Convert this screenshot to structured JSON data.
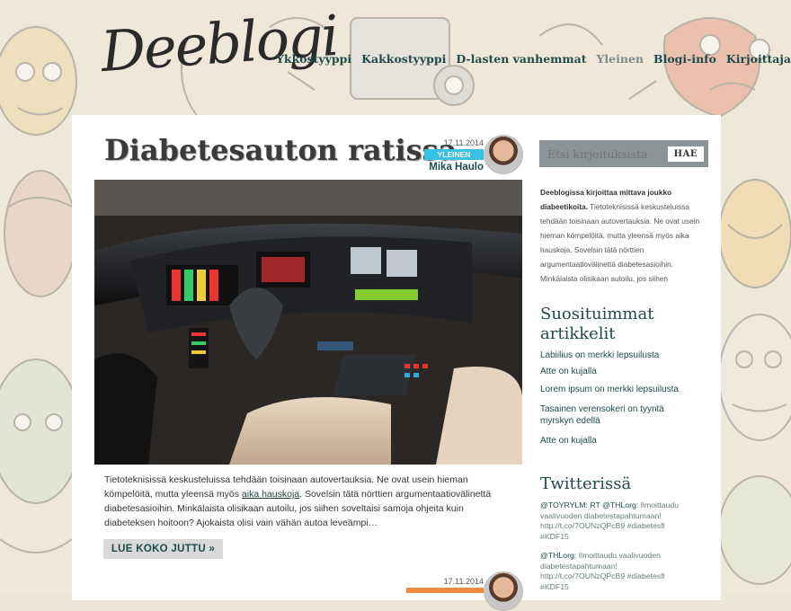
{
  "site": {
    "logo_text": "Deeblogi"
  },
  "nav": {
    "items": [
      {
        "label": "Ykköstyyppi",
        "active": false
      },
      {
        "label": "Kakkostyyppi",
        "active": false
      },
      {
        "label": "D-lasten vanhemmat",
        "active": false
      },
      {
        "label": "Yleinen",
        "active": true
      },
      {
        "label": "Blogi-info",
        "active": false
      },
      {
        "label": "Kirjoittajat",
        "active": false
      }
    ]
  },
  "post": {
    "title": "Diabetesauton ratissa",
    "date": "17.11.2014",
    "category": "YLEINEN",
    "author": "Mika Haulo",
    "excerpt_before": "Tietoteknisissä keskusteluissa tehdään toisinaan autovertauksia. Ne ovat usein hieman kömpelöitä, mutta yleensä myös ",
    "excerpt_link": "aika hauskoja",
    "excerpt_after": ". Sovelsin tätä nörttien argumentaatiovälinettä diabetesasioihin. Minkälaista olisikaan autoilu, jos siihen soveltaisi samoja ohjeita kuin diabeteksen hoitoon? Ajokaista olisi vain vähän autoa leveämpi…",
    "read_more": "LUE KOKO JUTTU »"
  },
  "post2": {
    "date": "17.11.2014"
  },
  "sidebar": {
    "search_placeholder": "Etsi kirjoituksista",
    "search_button": "HAE",
    "intro_bold": "Deeblogissa kirjoittaa mittava joukko diabeetikoita.",
    "intro_rest": " Tietoteknisissä keskusteluissa tehdään toisinaan autovertauksia. Ne ovat usein hieman kömpelöitä, mutta yleensä myös aika hauskoja. Sovelsin tätä nörttien argumentaatiovälinettä diabetesasioihin. Minkälaista olisikaan autoilu, jos siihen",
    "popular_heading": "Suosituimmat artikkelit",
    "popular": [
      "Labiilius on merkki lepsuilusta",
      "Atte on kujalla",
      "Lorem ipsum on merkki lepsuilusta",
      "Tasainen verensokeri on tyyntä myrskyn edellä",
      "Atte on kujalla"
    ],
    "twitter_heading": "Twitterissä",
    "tweets": [
      {
        "handle": "@TOYRYLM: RT @THLorg:",
        "text": " Ilmoittaudu vaalivuoden diabetestapahtumaan! http://t.co/7OUNzQPcB9 #diabetesfi #KDF15"
      },
      {
        "handle": "@THLorg:",
        "text": " Ilmoittaudu vaalivuoden diabetestapahtumaan! http://t.co/7OUNzQPcB9 #diabetesfi #KDF15"
      }
    ]
  },
  "colors": {
    "accent": "#1f4a4a",
    "category": "#37c1e6",
    "category2": "#f08a3c",
    "search_bg": "#8b9396"
  }
}
